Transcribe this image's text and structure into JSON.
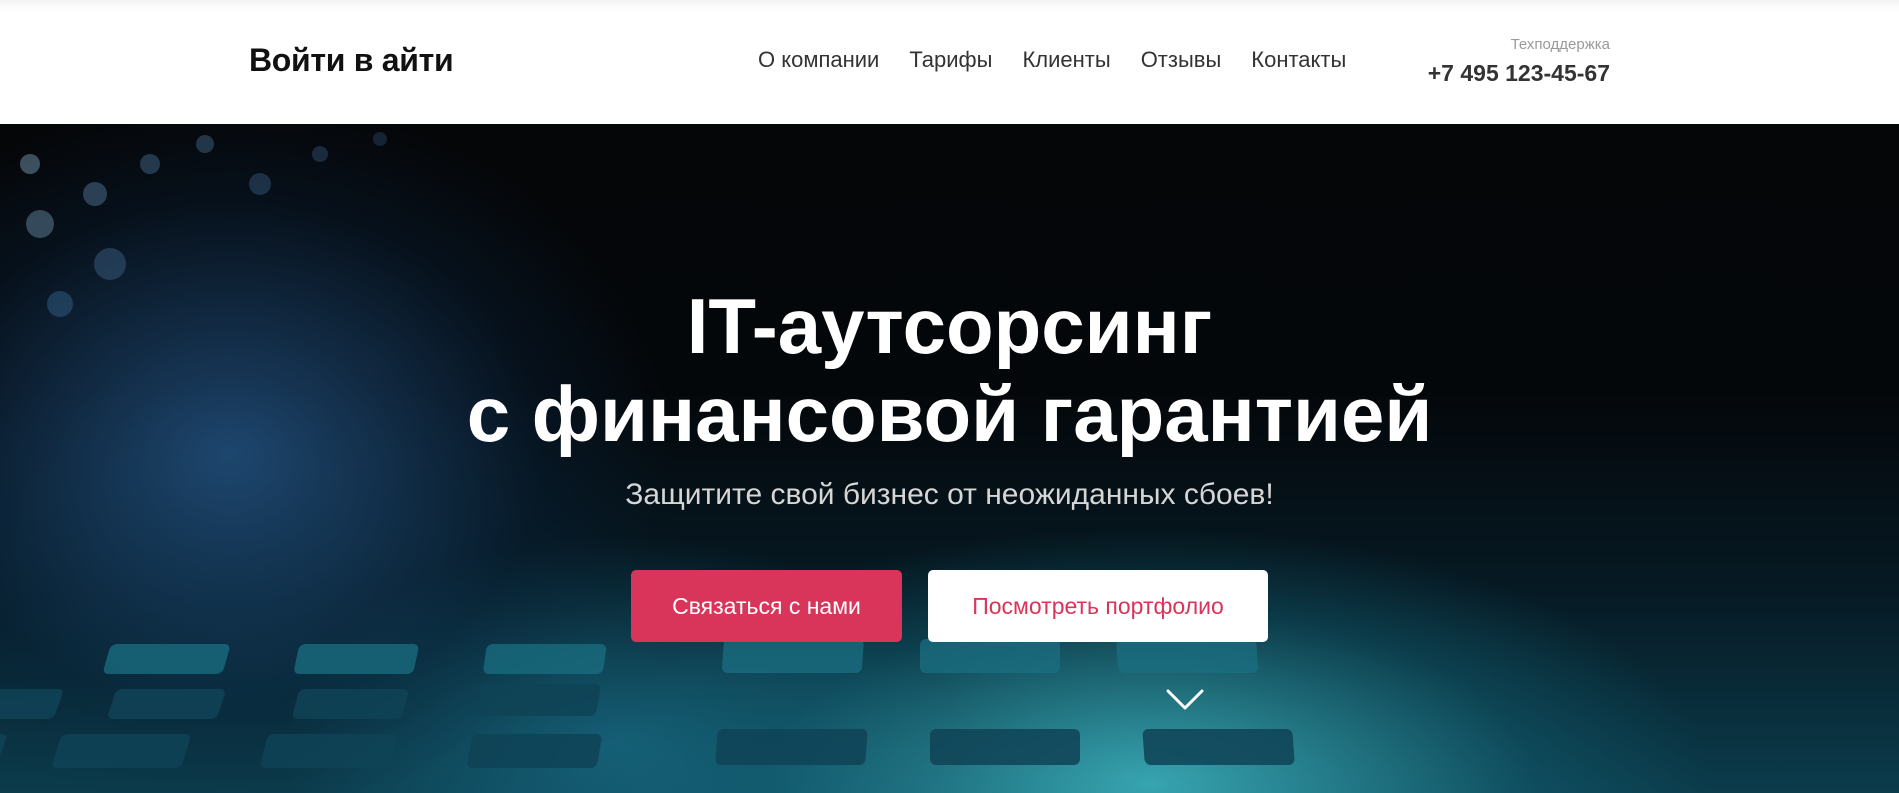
{
  "header": {
    "logo": "Войти в айти",
    "nav": [
      {
        "label": "О компании"
      },
      {
        "label": "Тарифы"
      },
      {
        "label": "Клиенты"
      },
      {
        "label": "Отзывы"
      },
      {
        "label": "Контакты"
      }
    ],
    "support": {
      "label": "Техподдержка",
      "phone": "+7 495 123-45-67"
    }
  },
  "hero": {
    "title_line1": "IT-аутсорсинг",
    "title_line2": "с финансовой гарантией",
    "subtitle": "Защитите свой бизнес от неожиданных сбоев!",
    "primary_button": "Связаться с нами",
    "secondary_button": "Посмотреть портфолио",
    "scroll_icon": "chevron-down-icon"
  },
  "colors": {
    "accent": "#d9345a",
    "header_bg": "#ffffff",
    "text_dark": "#333333",
    "muted": "#9a9a9a"
  }
}
